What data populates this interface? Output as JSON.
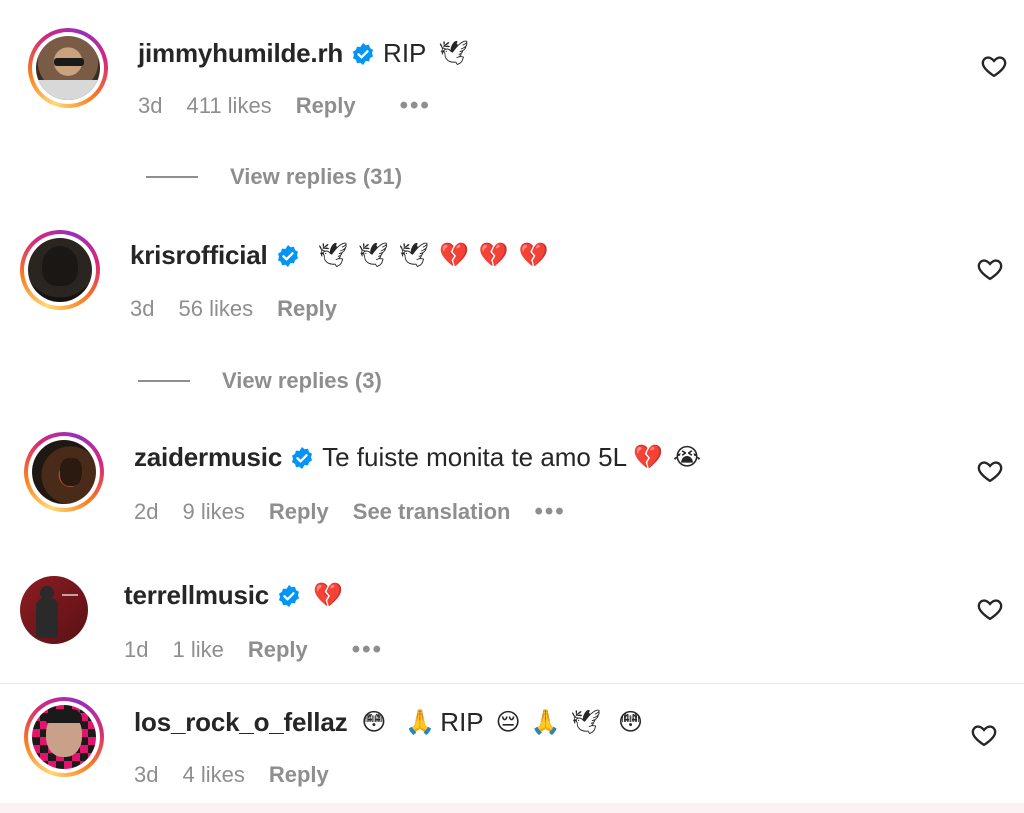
{
  "comments": [
    {
      "username": "jimmyhumilde.rh",
      "verified": true,
      "text": "RIP",
      "emojis": [
        "🕊"
      ],
      "time": "3d",
      "likes": "411 likes",
      "reply": "Reply",
      "translate": "",
      "more": "•••",
      "view_replies": "View replies (31)",
      "avatar_colors": [
        "#7a5b46",
        "#c9a27e"
      ]
    },
    {
      "username": "krisrofficial",
      "verified": true,
      "text": "",
      "emojis": [
        "🕊",
        "🕊",
        "🕊",
        "💔",
        "💔",
        "💔"
      ],
      "time": "3d",
      "likes": "56 likes",
      "reply": "Reply",
      "translate": "",
      "more": "",
      "view_replies": "View replies (3)",
      "avatar_colors": [
        "#2a2520",
        "#6b5c4c"
      ]
    },
    {
      "username": "zaidermusic",
      "verified": true,
      "text": "Te fuiste monita te amo 5L",
      "emojis": [
        "💔",
        "😭"
      ],
      "time": "2d",
      "likes": "9 likes",
      "reply": "Reply",
      "translate": "See translation",
      "more": "•••",
      "view_replies": "",
      "avatar_colors": [
        "#1f1712",
        "#a5522a"
      ]
    },
    {
      "username": "terrellmusic",
      "verified": true,
      "text": "",
      "emojis": [
        "💔"
      ],
      "time": "1d",
      "likes": "1 like",
      "reply": "Reply",
      "translate": "",
      "more": "•••",
      "view_replies": "",
      "avatar_colors": [
        "#5a1116",
        "#8c1d22"
      ]
    },
    {
      "username": "los_rock_o_fellaz",
      "verified": false,
      "text": "RIP",
      "emojis_before": [
        "😳",
        "🙏"
      ],
      "emojis": [
        "😔",
        "🙏",
        "🕊",
        "😳"
      ],
      "time": "3d",
      "likes": "4 likes",
      "reply": "Reply",
      "translate": "",
      "more": "",
      "view_replies": "",
      "avatar_colors": [
        "#e3126c",
        "#1a1a1a"
      ]
    }
  ],
  "icons": {
    "verified": "verified-badge-icon",
    "heart": "heart-outline-icon",
    "more": "more-options-icon"
  },
  "colors": {
    "verified_blue": "#0095f6",
    "secondary_text": "#8e8e8e",
    "primary_text": "#262626"
  }
}
